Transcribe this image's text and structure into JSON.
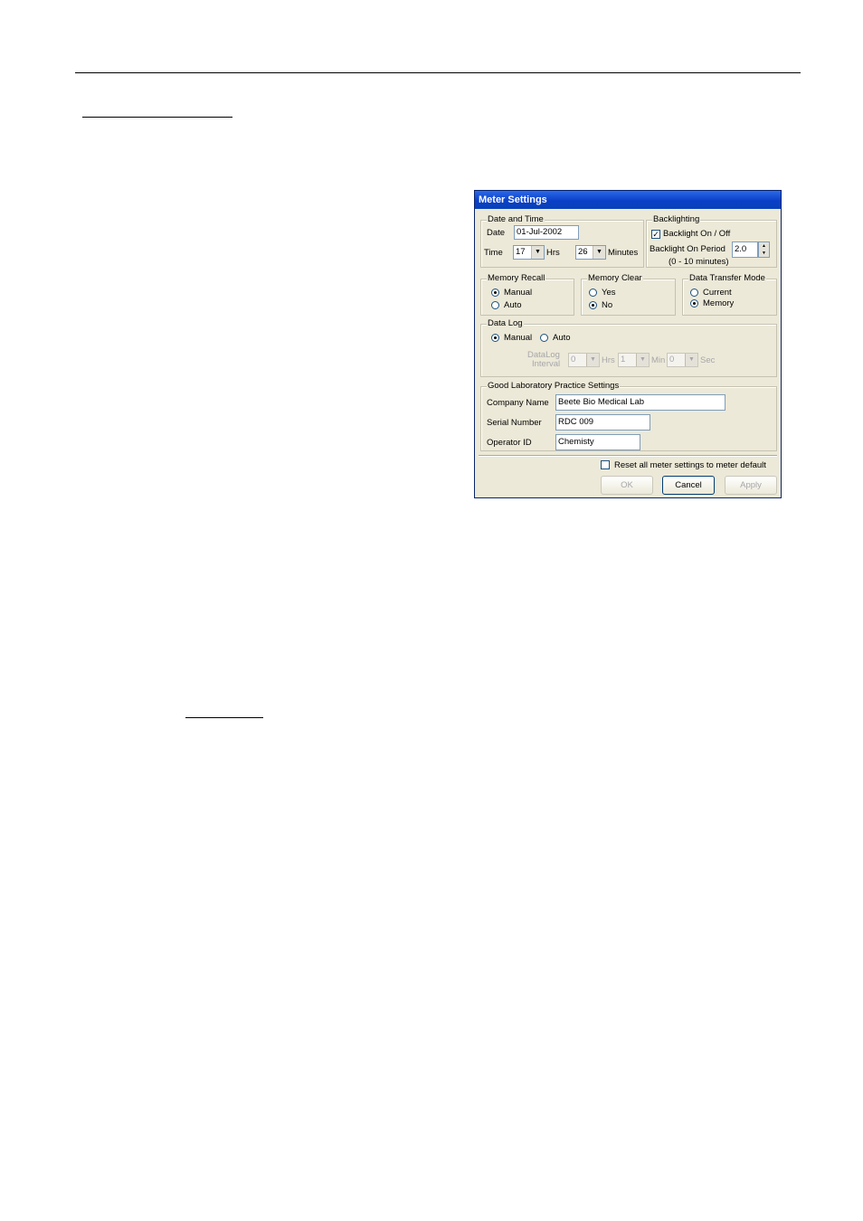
{
  "window": {
    "title": "Meter Settings"
  },
  "date_time": {
    "legend": "Date and Time",
    "date_label": "Date",
    "date_value": "01-Jul-2002",
    "time_label": "Time",
    "hours_value": "17",
    "hours_label": "Hrs",
    "minutes_value": "26",
    "minutes_label": "Minutes"
  },
  "backlighting": {
    "legend": "Backlighting",
    "checkbox_label": "Backlight On / Off",
    "checked": true,
    "period_label": "Backlight On Period",
    "period_value": "2.0",
    "range_note": "(0 - 10 minutes)"
  },
  "memory_recall": {
    "legend": "Memory Recall",
    "options": [
      "Manual",
      "Auto"
    ],
    "selected": "Manual"
  },
  "memory_clear": {
    "legend": "Memory Clear",
    "options": [
      "Yes",
      "No"
    ],
    "selected": "No"
  },
  "data_transfer": {
    "legend": "Data Transfer Mode",
    "options": [
      "Current",
      "Memory"
    ],
    "selected": "Memory"
  },
  "data_log": {
    "legend": "Data Log",
    "manual_label": "Manual",
    "auto_label": "Auto",
    "selected": "Manual",
    "interval_label_1": "DataLog",
    "interval_label_2": "Interval",
    "hrs_value": "0",
    "hrs_label": "Hrs",
    "min_value": "1",
    "min_label": "Min",
    "sec_value": "0",
    "sec_label": "Sec"
  },
  "glp": {
    "legend": "Good Laboratory Practice Settings",
    "company_label": "Company Name",
    "company_value": "Beete Bio Medical Lab",
    "serial_label": "Serial Number",
    "serial_value": "RDC 009",
    "operator_label": "Operator ID",
    "operator_value": "Chemisty"
  },
  "footer": {
    "reset_label": "Reset all meter settings to meter default",
    "ok_label": "OK",
    "cancel_label": "Cancel",
    "apply_label": "Apply"
  },
  "colors": {
    "titlebar": "#0a3fc7",
    "dialog_bg": "#ece9d8",
    "disabled_text": "#a7a6aa"
  },
  "icons": {
    "check": "check-mark-icon",
    "dropdown": "chevron-down-icon",
    "spin_up": "chevron-up-icon",
    "spin_down": "chevron-down-icon"
  }
}
